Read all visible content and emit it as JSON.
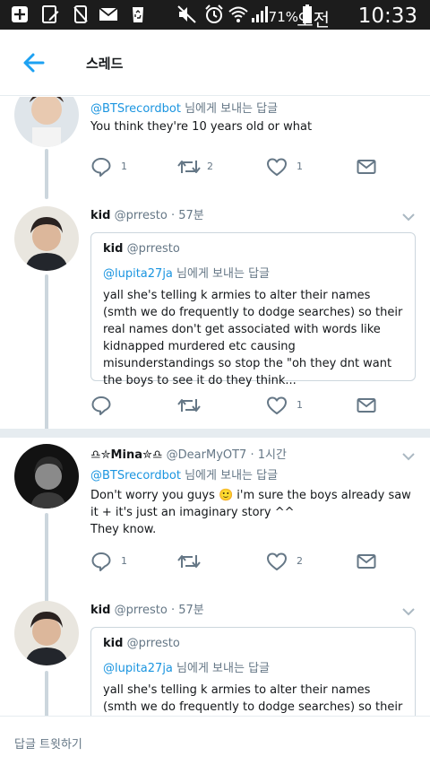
{
  "status_bar": {
    "battery_percent": "71%",
    "ampm": "오전",
    "time": "10:33"
  },
  "header": {
    "title": "스레드"
  },
  "tweets": [
    {
      "reply_to_handle": "@BTSrecordbot",
      "reply_to_suffix": "님에게 보내는 답글",
      "text": "You think they're 10 years old or what",
      "reply_count": "1",
      "retweet_count": "2",
      "like_count": "1"
    },
    {
      "name": "kid",
      "handle": "@prresto",
      "time": "· 57분",
      "quote": {
        "name": "kid",
        "handle": "@prresto",
        "reply_to_handle": "@lupita27ja",
        "reply_to_suffix": "님에게 보내는 답글",
        "text": "yall she's telling k armies to alter their names (smth we do frequently to dodge searches) so their real names don't get associated with words like kidnapped murdered etc causing misunderstandings so stop the \"oh they dnt want the boys to see it do they think..."
      },
      "reply_count": "",
      "retweet_count": "",
      "like_count": "1"
    },
    {
      "name": "♎✮Mina✮♎",
      "handle": "@DearMyOT7",
      "time": "· 1시간",
      "reply_to_handle": "@BTSrecordbot",
      "reply_to_suffix": "님에게 보내는 답글",
      "text_line1": "Don't worry you guys 🙂 i'm sure the boys already saw it + it's just an imaginary story ^^",
      "text_line2": "They know.",
      "reply_count": "1",
      "retweet_count": "",
      "like_count": "2"
    },
    {
      "name": "kid",
      "handle": "@prresto",
      "time": "· 57분",
      "quote": {
        "name": "kid",
        "handle": "@prresto",
        "reply_to_handle": "@lupita27ja",
        "reply_to_suffix": "님에게 보내는 답글",
        "text": "yall she's telling k armies to alter their names (smth we do frequently to dodge searches) so their real names"
      }
    }
  ],
  "reply_bar": {
    "placeholder": "답글 트윗하기"
  },
  "colors": {
    "accent": "#1da1f2",
    "link": "#1b95e0",
    "muted": "#657786",
    "line": "#ccd6dd"
  }
}
